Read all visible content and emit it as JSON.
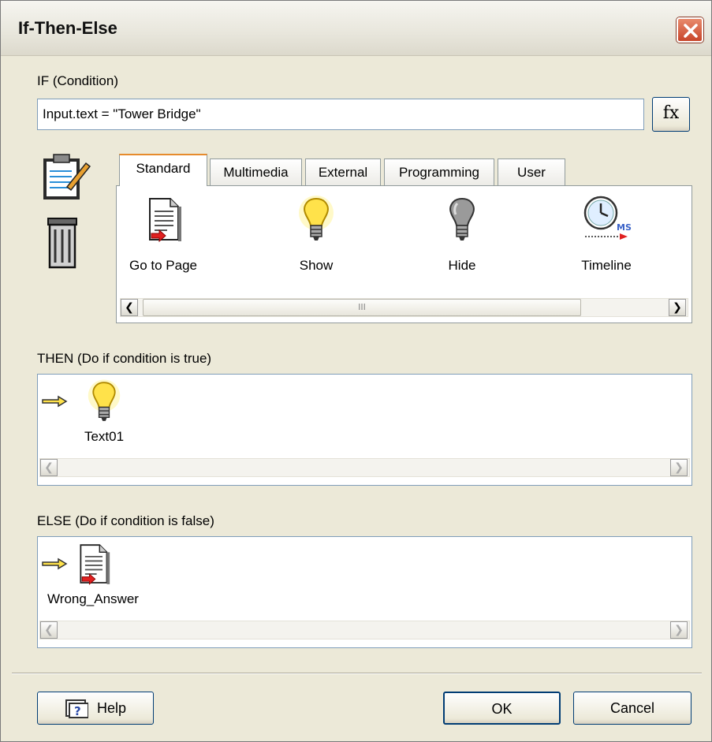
{
  "window": {
    "title": "If-Then-Else"
  },
  "condition": {
    "label": "IF (Condition)",
    "value": "Input.text = \"Tower Bridge\"",
    "fx_label": "fx"
  },
  "tabs": [
    {
      "label": "Standard",
      "active": true
    },
    {
      "label": "Multimedia",
      "active": false
    },
    {
      "label": "External",
      "active": false
    },
    {
      "label": "Programming",
      "active": false
    },
    {
      "label": "User",
      "active": false
    }
  ],
  "tools": [
    {
      "label": "Go to Page",
      "icon": "page-icon"
    },
    {
      "label": "Show",
      "icon": "lightbulb-on-icon"
    },
    {
      "label": "Hide",
      "icon": "lightbulb-off-icon"
    },
    {
      "label": "Timeline",
      "icon": "clock-icon",
      "badge": "MS"
    }
  ],
  "scroll": {
    "thumb_grip": "III"
  },
  "then": {
    "label": "THEN (Do if condition is true)",
    "item_label": "Text01",
    "item_icon": "lightbulb-on-icon"
  },
  "else": {
    "label": "ELSE (Do if condition is false)",
    "item_label": "Wrong_Answer",
    "item_icon": "page-icon"
  },
  "buttons": {
    "help": "Help",
    "ok": "OK",
    "cancel": "Cancel"
  },
  "colors": {
    "dialog_bg": "#ece9d8",
    "close_red": "#c8452a",
    "tab_highlight": "#e68b2c"
  }
}
